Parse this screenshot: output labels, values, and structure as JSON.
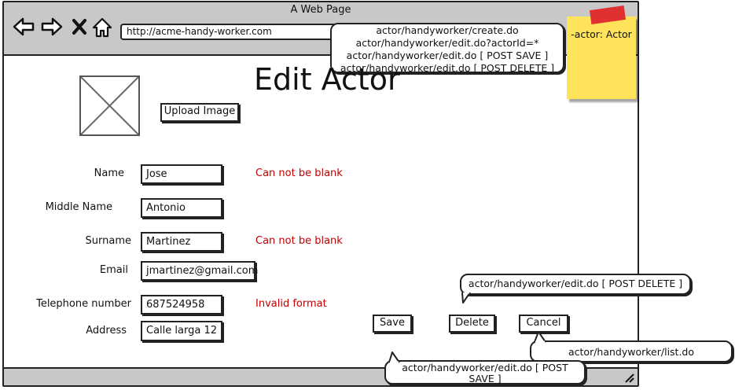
{
  "window": {
    "title": "A Web Page"
  },
  "browser": {
    "url": "http://acme-handy-worker.com",
    "icons": [
      "back-arrow-icon",
      "forward-arrow-icon",
      "close-x-icon",
      "home-icon"
    ]
  },
  "page": {
    "title": "Edit Actor",
    "upload_label": "Upload Image"
  },
  "form": {
    "name": {
      "label": "Name",
      "value": "Jose",
      "error": "Can not be blank"
    },
    "middle_name": {
      "label": "Middle Name",
      "value": "Antonio"
    },
    "surname": {
      "label": "Surname",
      "value": "Martinez",
      "error": "Can not be blank"
    },
    "email": {
      "label": "Email",
      "value": "jmartinez@gmail.com"
    },
    "telephone": {
      "label": "Telephone number",
      "value": "687524958",
      "error": "Invalid format"
    },
    "address": {
      "label": "Address",
      "value": "Calle larga 12"
    }
  },
  "actions": {
    "save": "Save",
    "delete": "Delete",
    "cancel": "Cancel"
  },
  "notes": {
    "top_bubble": [
      "actor/handyworker/create.do",
      "actor/handyworker/edit.do?actorId=*",
      "actor/handyworker/edit.do [ POST SAVE ]",
      "actor/handyworker/edit.do [ POST DELETE ]"
    ],
    "delete_bubble": "actor/handyworker/edit.do [ POST DELETE ]",
    "cancel_bubble": "actor/handyworker/list.do",
    "save_bubble": [
      "actor/handyworker/edit.do [ POST",
      "SAVE ]"
    ],
    "sticky": "-actor: Actor"
  },
  "colors": {
    "error": "#c00000",
    "chrome": "#c8c8c8",
    "sticky": "#ffe35a",
    "tape": "#e03030"
  }
}
